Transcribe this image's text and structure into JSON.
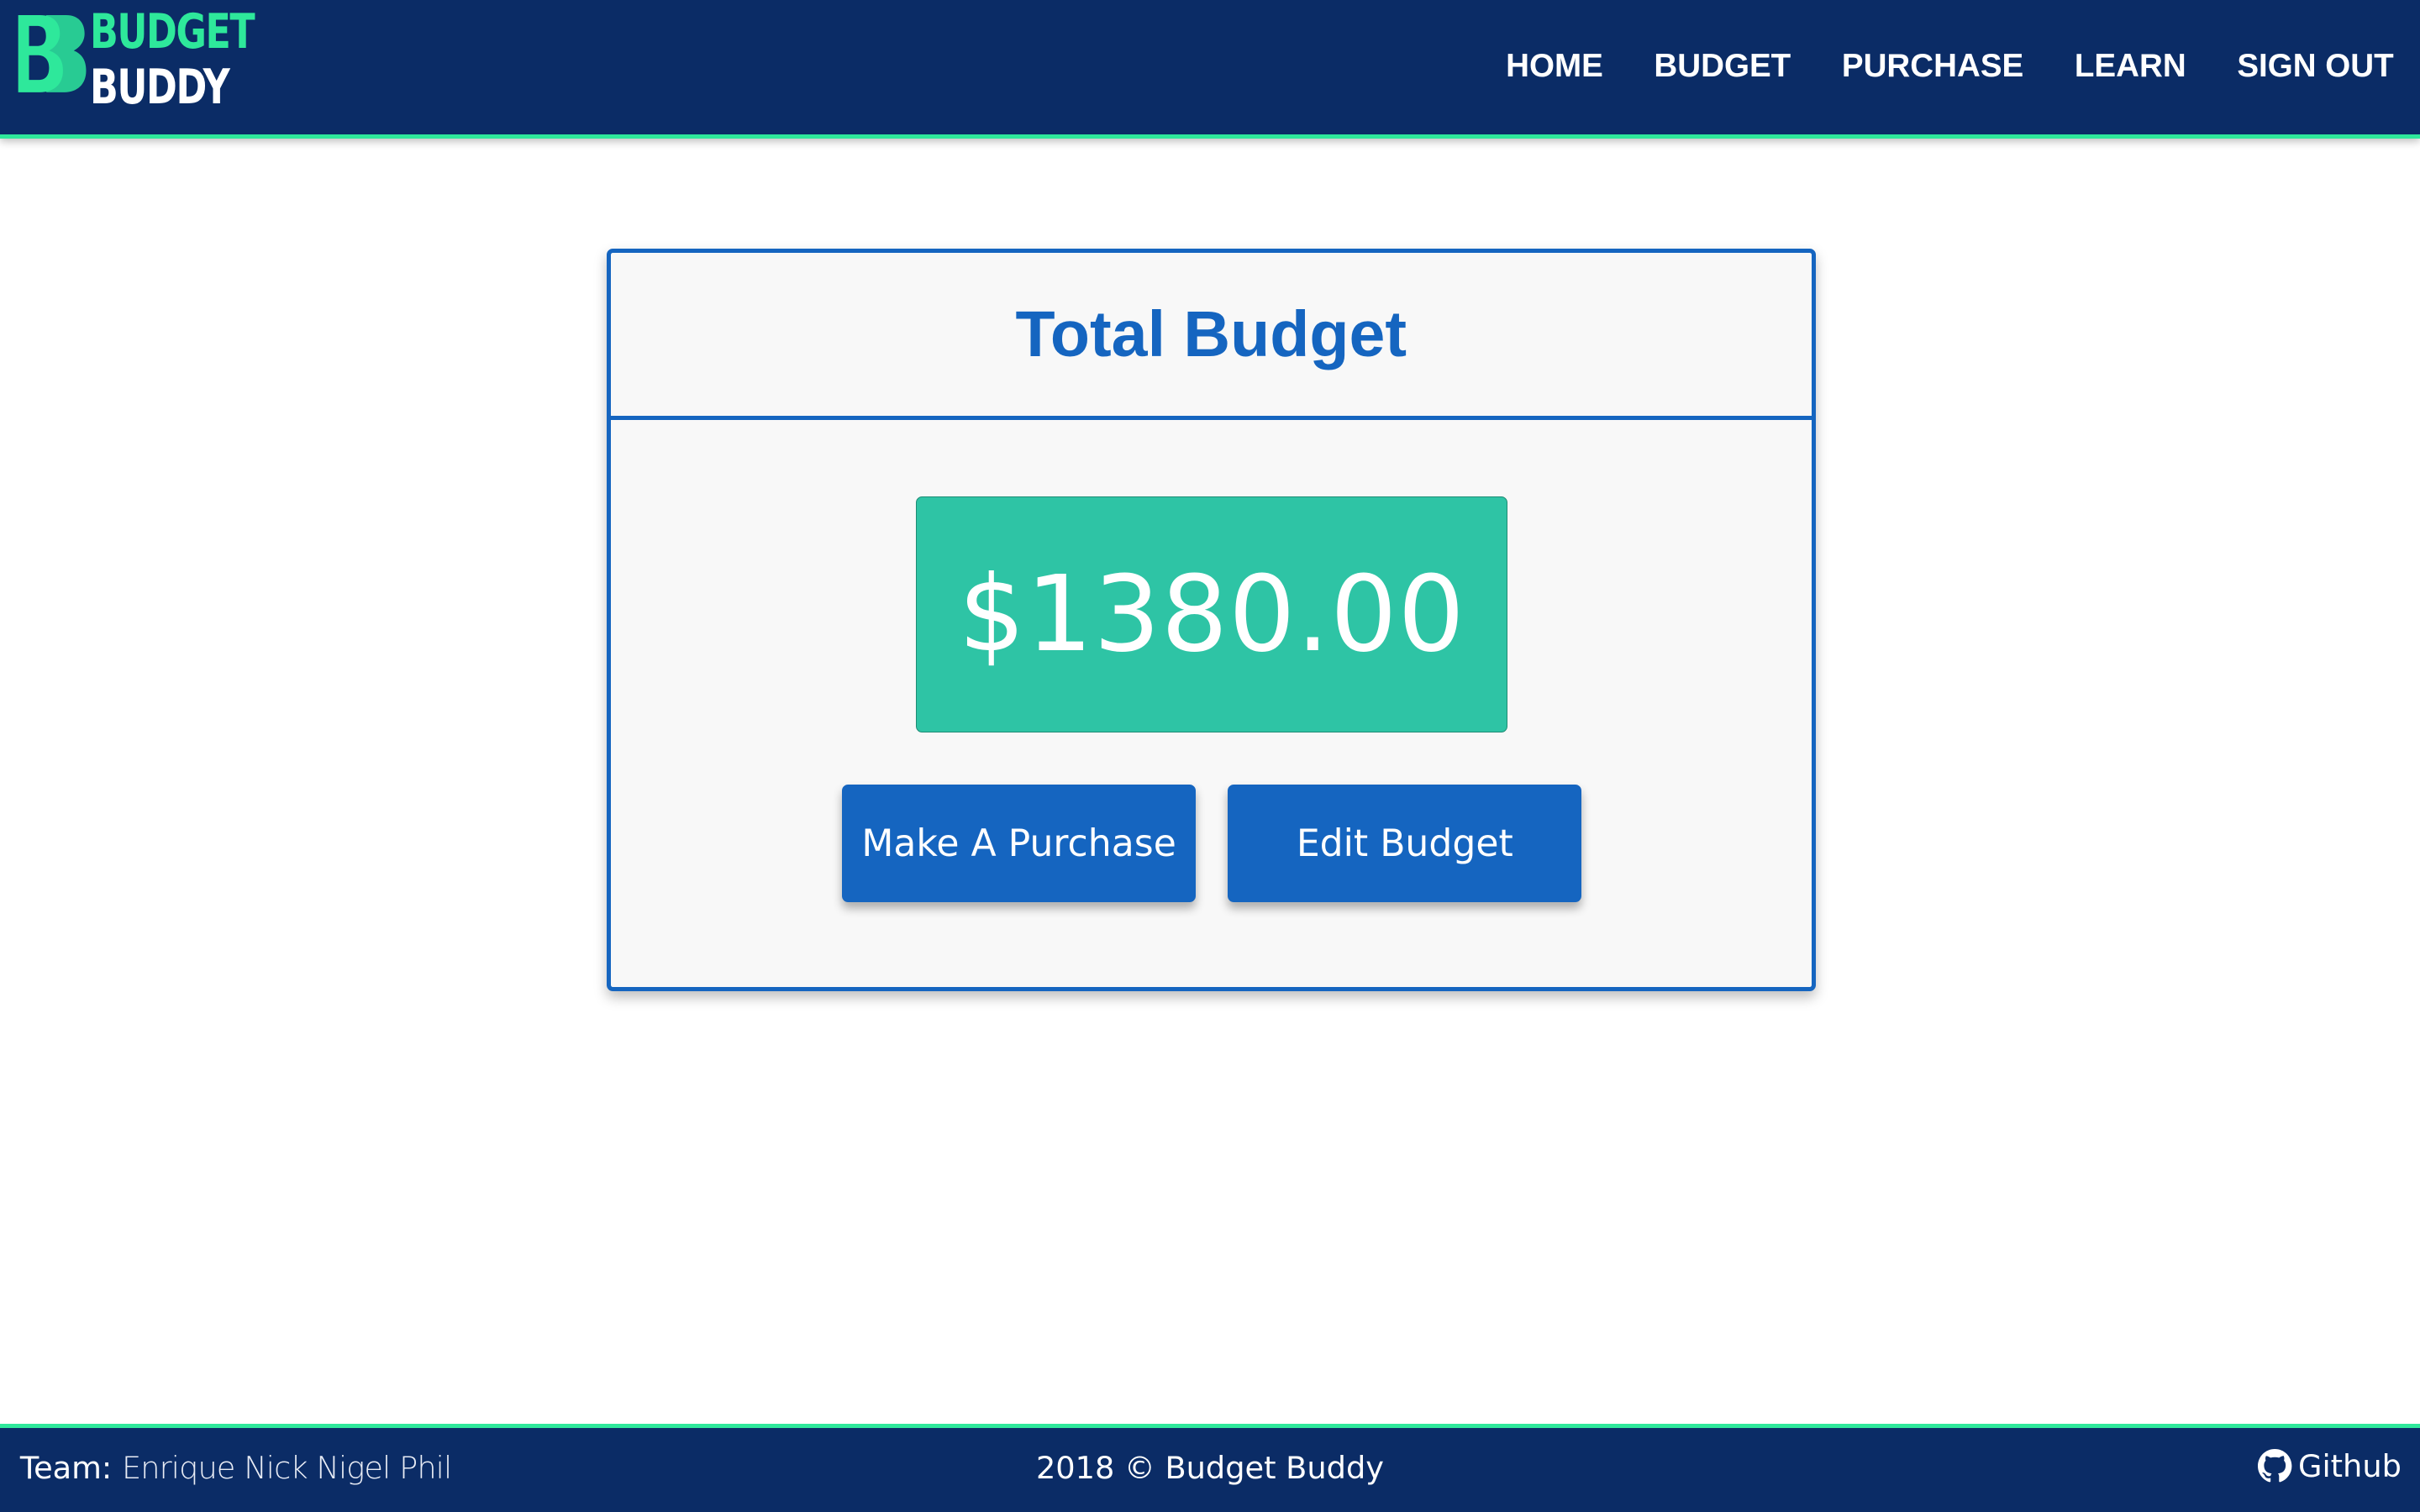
{
  "header": {
    "logo": {
      "line1": "BUDGET",
      "line2": "BUDDY",
      "mark": "BB",
      "accent_color": "#2ee89b"
    },
    "nav": [
      {
        "label": "HOME"
      },
      {
        "label": "BUDGET"
      },
      {
        "label": "PURCHASE"
      },
      {
        "label": "LEARN"
      },
      {
        "label": "SIGN OUT"
      }
    ],
    "background_color": "#0b2c66"
  },
  "card": {
    "title": "Total Budget",
    "amount": "$1380.00",
    "amount_color": "#2ec4a5",
    "buttons": {
      "purchase": "Make A Purchase",
      "edit": "Edit Budget"
    },
    "primary_color": "#1565c0"
  },
  "footer": {
    "team_label": "Team:",
    "team_names": "Enrique Nick Nigel Phil",
    "copyright": "2018 © Budget Buddy",
    "github_label": "Github",
    "github_icon": "github-icon"
  }
}
